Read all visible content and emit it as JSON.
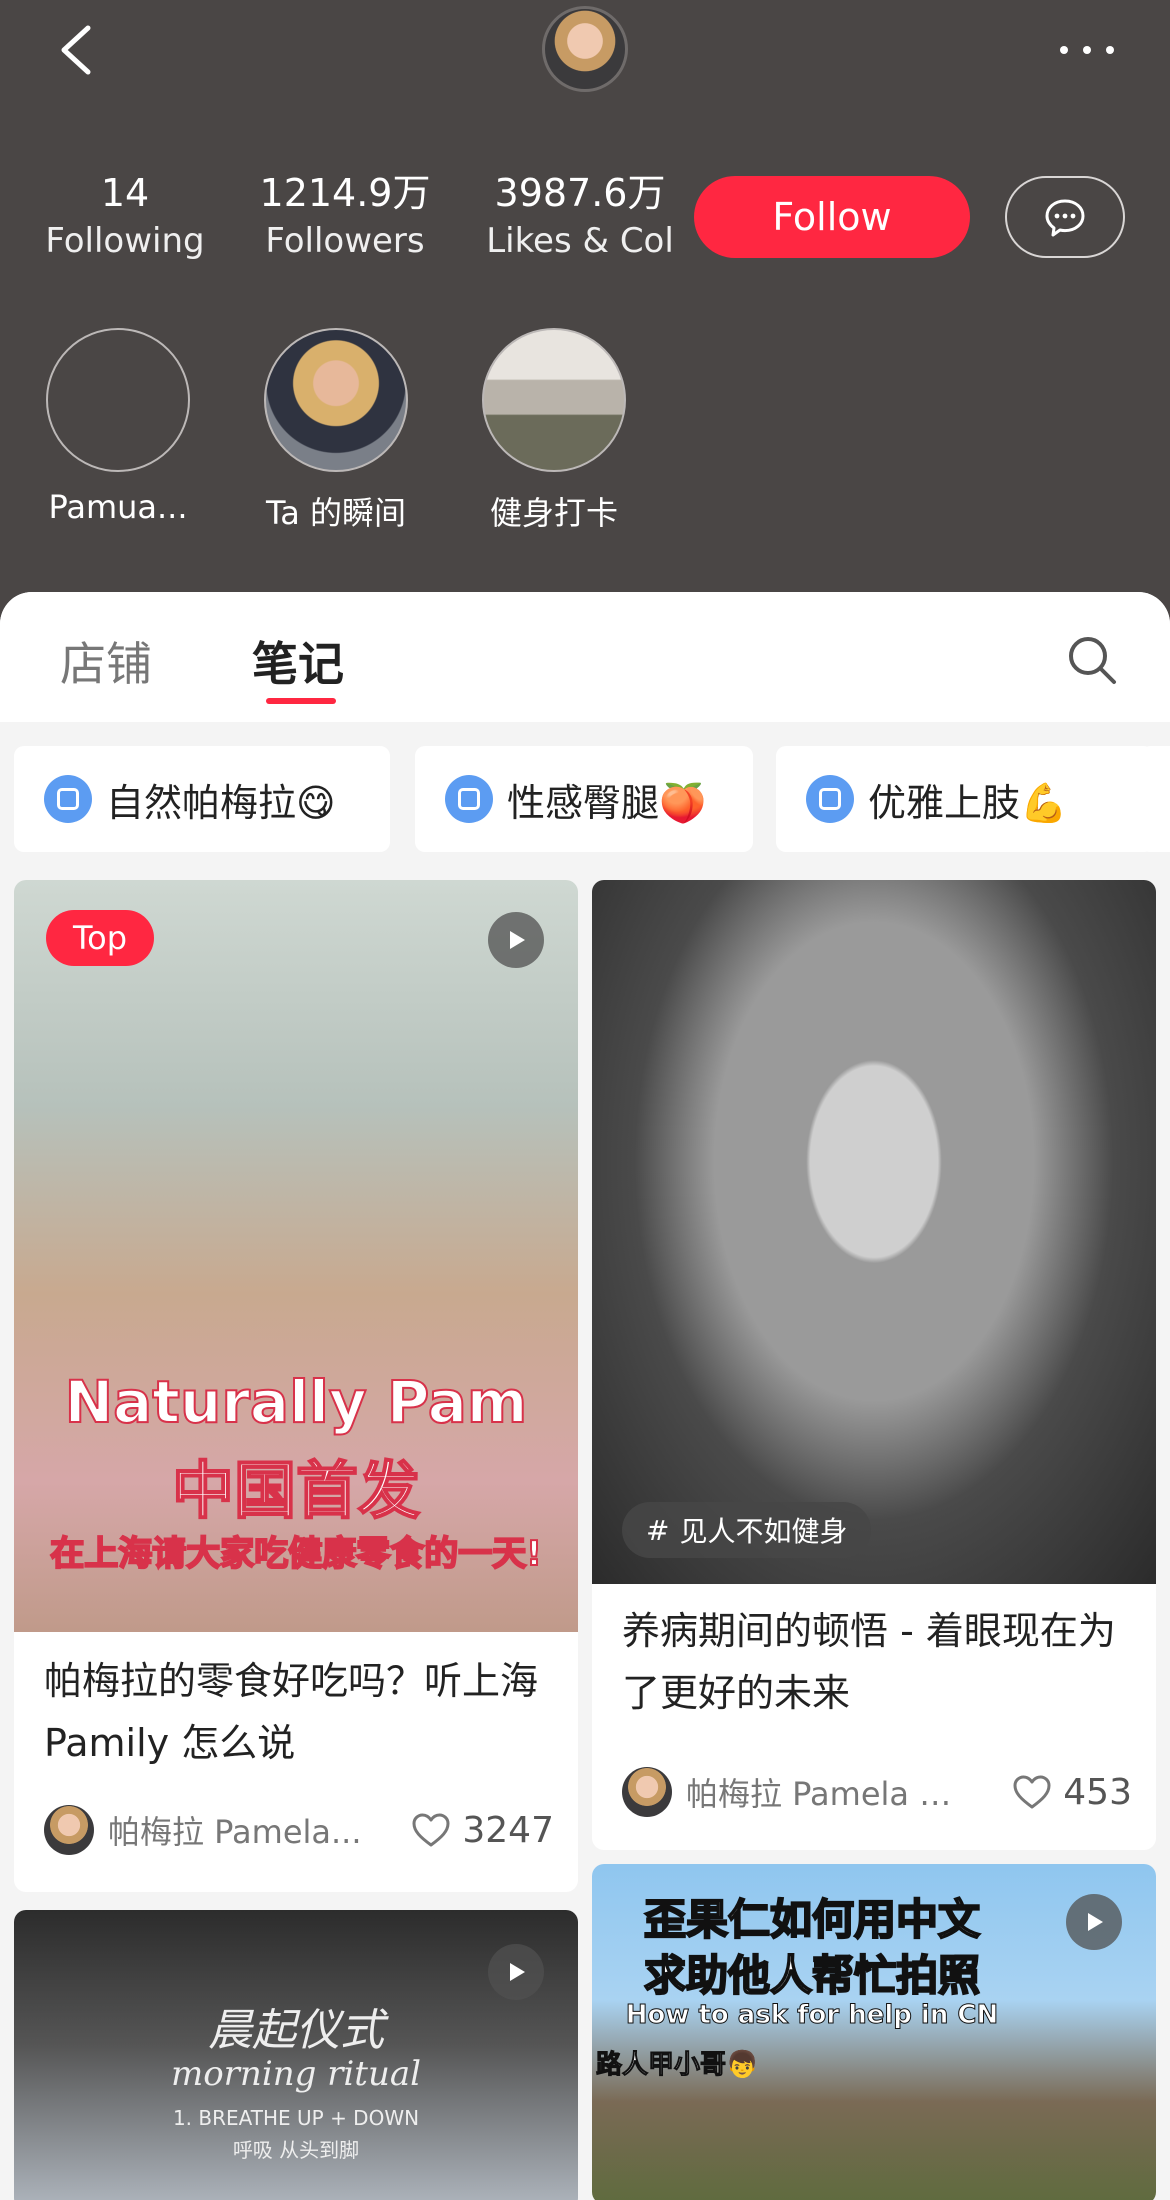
{
  "header": {
    "stats": {
      "following": {
        "value": "14",
        "label": "Following"
      },
      "followers": {
        "value": "1214.9万",
        "label": "Followers"
      },
      "likes": {
        "value": "3987.6万",
        "label": "Likes & Col"
      }
    },
    "follow_label": "Follow",
    "highlights": [
      {
        "name": "Pamua..."
      },
      {
        "name": "Ta 的瞬间"
      },
      {
        "name": "健身打卡"
      }
    ]
  },
  "tabs": [
    {
      "label": "店铺"
    },
    {
      "label": "笔记"
    }
  ],
  "chips": [
    {
      "label": "自然帕梅拉😋"
    },
    {
      "label": "性感臀腿🍑"
    },
    {
      "label": "优雅上肢💪"
    }
  ],
  "cards": [
    {
      "badge": "Top",
      "overlay": [
        "Naturally Pam",
        "中国首发",
        "在上海请大家吃健康零食的一天!"
      ],
      "title": "帕梅拉的零食好吃吗？听上海Pamily 怎么说",
      "author": "帕梅拉 Pamela...",
      "likes": "3247"
    },
    {
      "tag": "见人不如健身",
      "title": "养病期间的顿悟 - 着眼现在为了更好的未来",
      "author": "帕梅拉 Pamela R...",
      "likes": "453"
    },
    {
      "overlay": [
        "晨起仪式",
        "morning ritual",
        "1. BREATHE UP + DOWN",
        "呼吸 从头到脚"
      ]
    },
    {
      "overlay": [
        "歪果仁如何用中文",
        "求助他人帮忙拍照",
        "How to ask for help in CN",
        "路人甲小哥👦"
      ]
    }
  ],
  "colors": {
    "accent": "#ff2741",
    "header_bg": "#4a4645",
    "chip_icon": "#5c9cf2"
  }
}
